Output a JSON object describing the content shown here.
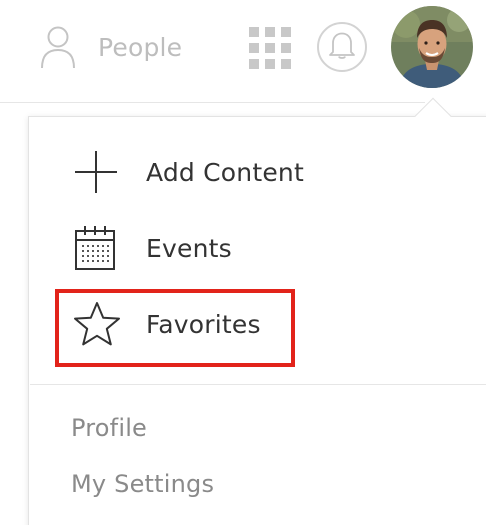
{
  "nav": {
    "people_label": "People",
    "icons": {
      "people": "person-outline-icon",
      "apps": "grid-icon",
      "notifications": "bell-icon",
      "avatar": "user-avatar"
    }
  },
  "menu": {
    "items": [
      {
        "label": "Add Content",
        "icon": "plus-icon"
      },
      {
        "label": "Events",
        "icon": "calendar-icon"
      },
      {
        "label": "Favorites",
        "icon": "star-icon",
        "highlighted": true
      }
    ],
    "secondary": [
      {
        "label": "Profile"
      },
      {
        "label": "My Settings"
      }
    ]
  },
  "colors": {
    "highlight": "#e2231a",
    "text_primary": "#333333",
    "text_secondary": "#8a8a8a",
    "nav_muted": "#bdbdbd"
  }
}
